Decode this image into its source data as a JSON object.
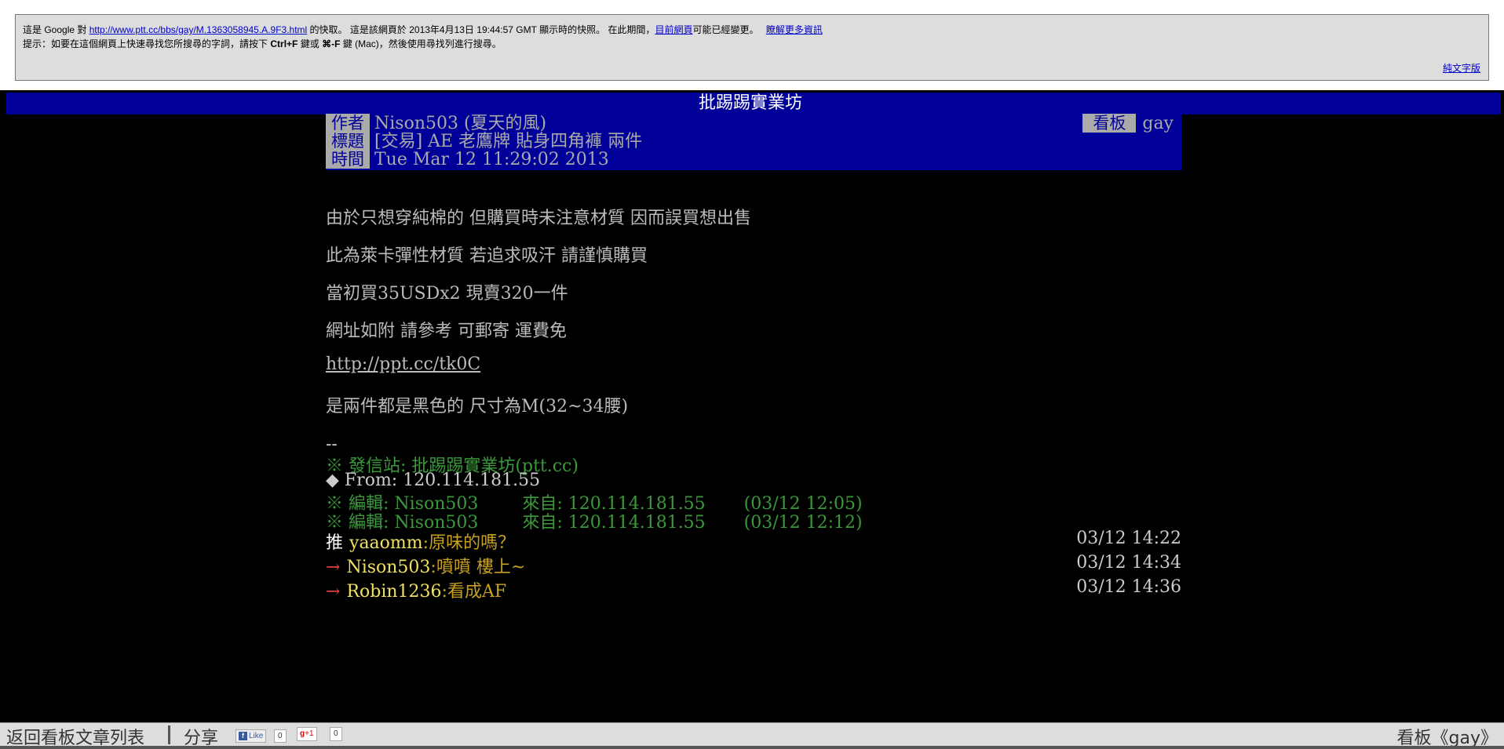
{
  "cache_banner": {
    "prefix": "這是 Google 對",
    "url": "http://www.ptt.cc/bbs/gay/M.1363058945.A.9F3.html",
    "middle": "的快取。 這是該網頁於 2013年4月13日 19:44:57 GMT 顯示時的快照。 在此期間，",
    "current_page_link": "目前網頁",
    "after_current": "可能已經變更。",
    "learn_more_link": "瞭解更多資訊",
    "hint_prefix": "提示：如要在這個網頁上快速尋找您所搜尋的字詞，請按下",
    "hint_key1": "Ctrl+F",
    "hint_mid": "鍵或",
    "hint_key2": "⌘-F",
    "hint_suffix": "鍵 (Mac)，然後使用尋找列進行搜尋。",
    "text_only_link": "純文字版"
  },
  "site": {
    "title": "批踢踢實業坊"
  },
  "article": {
    "author_label": "作者",
    "author_value": "Nison503 (夏天的風)",
    "title_label": "標題",
    "title_value": "[交易] AE 老鷹牌 貼身四角褲 兩件",
    "time_label": "時間",
    "time_value": "Tue Mar 12 11:29:02 2013",
    "board_label": "看板",
    "board_value": "gay"
  },
  "content": {
    "lines": [
      "由於只想穿純棉的 但購買時未注意材質 因而誤買想出售",
      "此為萊卡彈性材質 若追求吸汗 請謹慎購買",
      "當初買35USDx2 現賣320一件",
      "網址如附 請參考   可郵寄 運費免",
      "http://ppt.cc/tk0C",
      "是兩件都是黑色的 尺寸為M(32~34腰)"
    ]
  },
  "signature": {
    "dashes": "--",
    "origin": "※ 發信站: 批踢踢實業坊(ptt.cc)",
    "from": "◆ From: 120.114.181.55",
    "edit1": "※ 編輯: Nison503        來自: 120.114.181.55       (03/12 12:05)",
    "edit2": "※ 編輯: Nison503        來自: 120.114.181.55       (03/12 12:12)"
  },
  "pushes": [
    {
      "tag": "推",
      "user": "yaaomm",
      "msg": ":原味的嗎？",
      "time": "03/12 14:22"
    },
    {
      "tag": "→",
      "user": "Nison503",
      "msg": ":噴噴 樓上~",
      "time": "03/12 14:34"
    },
    {
      "tag": "→",
      "user": "Robin1236",
      "msg": ":看成AF",
      "time": "03/12 14:36"
    }
  ],
  "bottom_bar": {
    "back_label": "返回看板文章列表",
    "share_label": "分享",
    "fb_like": "Like",
    "fb_count": "0",
    "gplus_label": "+1",
    "gplus_count": "0",
    "board_link": "看板《gay》"
  }
}
